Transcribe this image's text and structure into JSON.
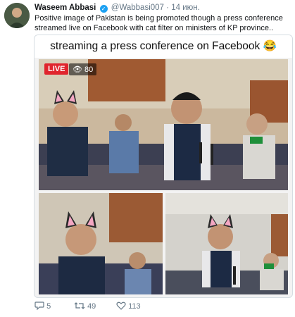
{
  "tweet": {
    "author_name": "Waseem Abbasi",
    "handle": "@Wabbasi007",
    "separator": "·",
    "date": "14 июн.",
    "text": "Positive image of Pakistan is being promoted though a press conference streamed live on Facebook with cat filter on ministers of KP province..",
    "verified": true
  },
  "media": {
    "caption": "streaming a press conference on Facebook 😂",
    "live_label": "LIVE",
    "viewer_count": "80"
  },
  "actions": {
    "replies": "5",
    "retweets": "49",
    "likes": "113"
  },
  "colors": {
    "verified": "#1da1f2",
    "live_badge": "#e0242d",
    "muted_text": "#657786"
  }
}
